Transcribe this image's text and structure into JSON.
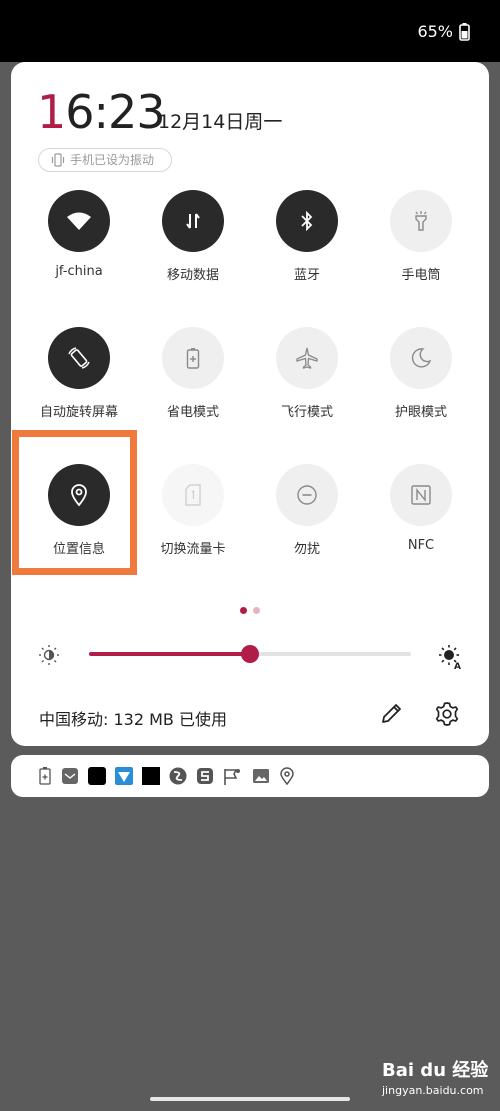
{
  "status_bar": {
    "battery_percent": "65%"
  },
  "header": {
    "time_first": "1",
    "time_rest": "6:23",
    "date": "12月14日周一",
    "vibrate_notice": "手机已设为振动"
  },
  "tiles": [
    {
      "label": "jf-china",
      "icon": "wifi-icon",
      "state": "on"
    },
    {
      "label": "移动数据",
      "icon": "mobile-data-icon",
      "state": "on"
    },
    {
      "label": "蓝牙",
      "icon": "bluetooth-icon",
      "state": "on"
    },
    {
      "label": "手电筒",
      "icon": "flashlight-icon",
      "state": "off"
    },
    {
      "label": "自动旋转屏幕",
      "icon": "auto-rotate-icon",
      "state": "on"
    },
    {
      "label": "省电模式",
      "icon": "battery-saver-icon",
      "state": "off"
    },
    {
      "label": "飞行模式",
      "icon": "airplane-icon",
      "state": "off"
    },
    {
      "label": "护眼模式",
      "icon": "moon-icon",
      "state": "off"
    },
    {
      "label": "位置信息",
      "icon": "location-icon",
      "state": "on"
    },
    {
      "label": "切换流量卡",
      "icon": "sim-card-icon",
      "state": "disabled"
    },
    {
      "label": "勿扰",
      "icon": "do-not-disturb-icon",
      "state": "off"
    },
    {
      "label": "NFC",
      "icon": "nfc-icon",
      "state": "off"
    }
  ],
  "brightness": {
    "level": 0.5,
    "low_icon": "brightness-low-icon",
    "auto_icon": "brightness-auto-icon",
    "auto_letter": "A"
  },
  "footer": {
    "data_usage": "中国移动: 132 MB 已使用",
    "edit_icon": "pencil-icon",
    "settings_icon": "gear-icon"
  },
  "page_indicator": {
    "pages": 2,
    "current": 0
  },
  "notification_icons": [
    "battery-saver-icon",
    "mail-icon",
    "app-icon",
    "ticket-app-icon",
    "app-icon",
    "swirl-app-icon",
    "s-app-icon",
    "flag-app-icon",
    "gallery-icon",
    "location-icon"
  ],
  "watermark": {
    "main": "Bai du 经验",
    "sub": "jingyan.baidu.com"
  },
  "colors": {
    "accent": "#b01e47",
    "highlight": "#f07a3d",
    "tile_on": "#2a2a2a",
    "tile_off": "#efefef",
    "backdrop": "#5b5b5b"
  }
}
